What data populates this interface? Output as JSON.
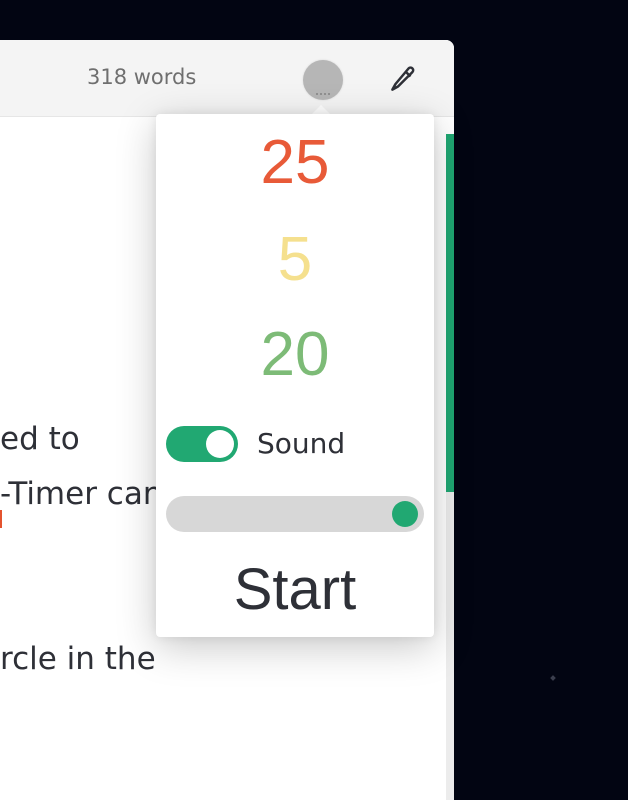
{
  "toolbar": {
    "word_count": "318 words",
    "timer_icon": "timer-circle-icon",
    "edit_icon": "pencil-icon"
  },
  "editor": {
    "lines": [
      "ed to",
      "-Timer can",
      "rcle in the"
    ]
  },
  "timer_popover": {
    "work_minutes": "25",
    "short_break_minutes": "5",
    "long_break_minutes": "20",
    "sound_label": "Sound",
    "sound_enabled": true,
    "volume_level": 1.0,
    "start_label": "Start"
  },
  "colors": {
    "work": "#e85a38",
    "short_break": "#f5e08e",
    "long_break": "#7dbb77",
    "accent": "#21a872",
    "background": "#020512"
  }
}
